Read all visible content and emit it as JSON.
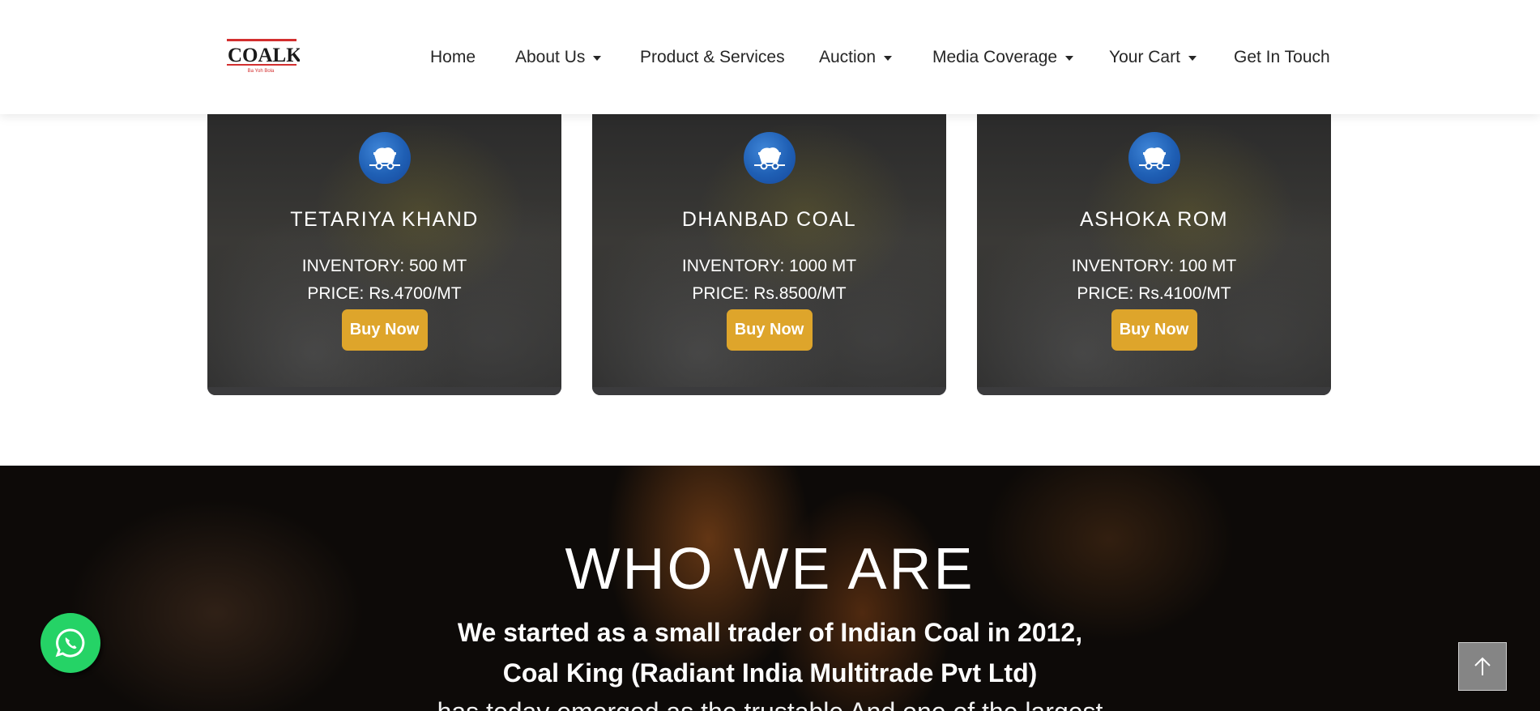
{
  "header": {
    "logo_text": "COALKING",
    "logo_tagline": "Ba Yoh Bola"
  },
  "nav": {
    "items": [
      {
        "label": "Home",
        "has_dropdown": false
      },
      {
        "label": "About Us",
        "has_dropdown": true
      },
      {
        "label": "Product & Services",
        "has_dropdown": false
      },
      {
        "label": "Auction",
        "has_dropdown": true
      },
      {
        "label": "Media Coverage",
        "has_dropdown": true
      },
      {
        "label": "Your Cart",
        "has_dropdown": true
      },
      {
        "label": "Get In Touch",
        "has_dropdown": false
      }
    ]
  },
  "products": [
    {
      "icon": "coal-cart-icon",
      "name": "TETARIYA KHAND",
      "inventory": "INVENTORY: 500 MT",
      "price": "PRICE: Rs.4700/MT",
      "button": "Buy Now"
    },
    {
      "icon": "coal-cart-icon",
      "name": "DHANBAD COAL",
      "inventory": "INVENTORY: 1000 MT",
      "price": "PRICE: Rs.8500/MT",
      "button": "Buy Now"
    },
    {
      "icon": "coal-cart-icon",
      "name": "ASHOKA ROM",
      "inventory": "INVENTORY: 100 MT",
      "price": "PRICE: Rs.4100/MT",
      "button": "Buy Now"
    }
  ],
  "who_we_are": {
    "heading": "WHO WE ARE",
    "line1": "We started as a small trader of Indian Coal in 2012,",
    "line2": "Coal King (Radiant India Multitrade Pvt Ltd)",
    "line3": "has today emerged as the trustable And one of the largest"
  },
  "floating": {
    "whatsapp_icon": "whatsapp-icon",
    "scroll_top_icon": "arrow-up-icon"
  },
  "colors": {
    "accent_button": "#dea52b",
    "icon_blue": "#1f5fb4",
    "whatsapp_green": "#25d366",
    "logo_red": "#d32f2f"
  }
}
